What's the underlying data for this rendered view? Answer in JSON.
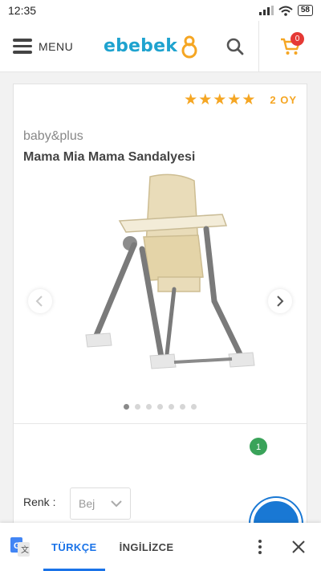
{
  "status": {
    "time": "12:35",
    "battery": "58"
  },
  "header": {
    "menu_label": "MENU",
    "logo_text": "ebebek",
    "cart_count": "0"
  },
  "product": {
    "rating_stars": 5,
    "age": "2 OY",
    "brand": "baby&plus",
    "name": "Mama Mia Mama Sandalyesi",
    "image_count": 7,
    "active_image": 0,
    "green_badge": "1",
    "color_label": "Renk :",
    "color_value": "Bej"
  },
  "translate": {
    "tab_source": "TÜRKÇE",
    "tab_target": "İNGİLİZCE"
  },
  "colors": {
    "brand_blue": "#1fa3cf",
    "brand_orange": "#f5a623",
    "cart_badge": "#e53935",
    "translate_blue": "#1a73e8",
    "chair_beige": "#e9dcb9"
  }
}
